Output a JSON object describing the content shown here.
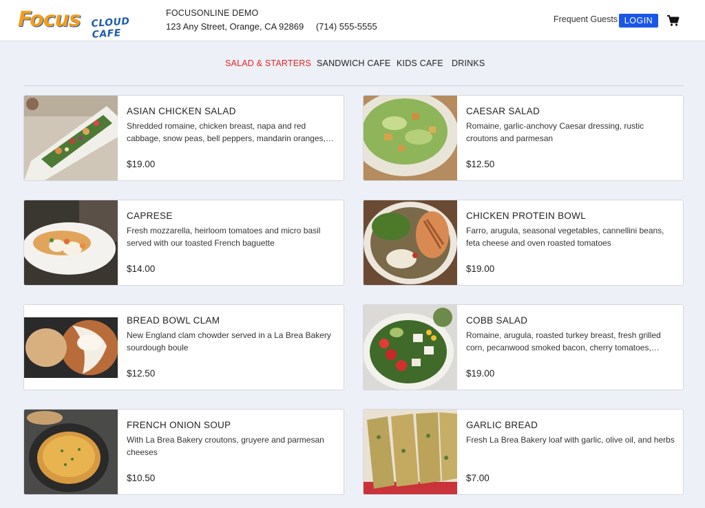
{
  "brand": {
    "logo_main": "Focus",
    "logo_sub": "CLOUD CAFE"
  },
  "store": {
    "name": "FOCUSONLINE DEMO",
    "address": "123 Any Street, Orange, CA 92869",
    "phone": "(714) 555-5555"
  },
  "header": {
    "frequent_guests": "Frequent Guests",
    "login": "LOGIN",
    "cart_icon": "cart-icon"
  },
  "nav": {
    "items": [
      {
        "label": "SALAD & STARTERS",
        "active": true
      },
      {
        "label": "SANDWICH CAFE",
        "active": false
      },
      {
        "label": "KIDS CAFE",
        "active": false
      },
      {
        "label": "DRINKS",
        "active": false
      }
    ]
  },
  "colors": {
    "accent": "#1a56e8",
    "active_nav": "#e02424",
    "logo_orange": "#f39c1c",
    "logo_blue": "#1d5dad",
    "page_bg": "#eef0f8"
  },
  "menu": [
    {
      "title": "ASIAN CHICKEN SALAD",
      "desc": "Shredded romaine, chicken breast, napa and red cabbage, snow peas, bell peppers, mandarin oranges, rice noodles",
      "price": "$19.00"
    },
    {
      "title": "CAESAR SALAD",
      "desc": "Romaine, garlic-anchovy Caesar dressing, rustic croutons and parmesan",
      "price": "$12.50"
    },
    {
      "title": "CAPRESE",
      "desc": "Fresh mozzarella, heirloom tomatoes and micro basil served with our toasted French baguette",
      "price": "$14.00"
    },
    {
      "title": "CHICKEN PROTEIN BOWL",
      "desc": "Farro, arugula, seasonal vegetables, cannellini beans, feta cheese and oven roasted tomatoes",
      "price": "$19.00"
    },
    {
      "title": "BREAD BOWL CLAM",
      "desc": "New England clam chowder served in a La Brea Bakery sourdough boule",
      "price": "$12.50"
    },
    {
      "title": "COBB SALAD",
      "desc": "Romaine, arugula, roasted turkey breast, fresh grilled corn, pecanwood smoked bacon, cherry tomatoes, avocado",
      "price": "$19.00"
    },
    {
      "title": "FRENCH ONION SOUP",
      "desc": "With La Brea Bakery croutons, gruyere and parmesan cheeses",
      "price": "$10.50"
    },
    {
      "title": "GARLIC BREAD",
      "desc": "Fresh La Brea Bakery loaf with garlic, olive oil, and herbs",
      "price": "$7.00"
    }
  ]
}
